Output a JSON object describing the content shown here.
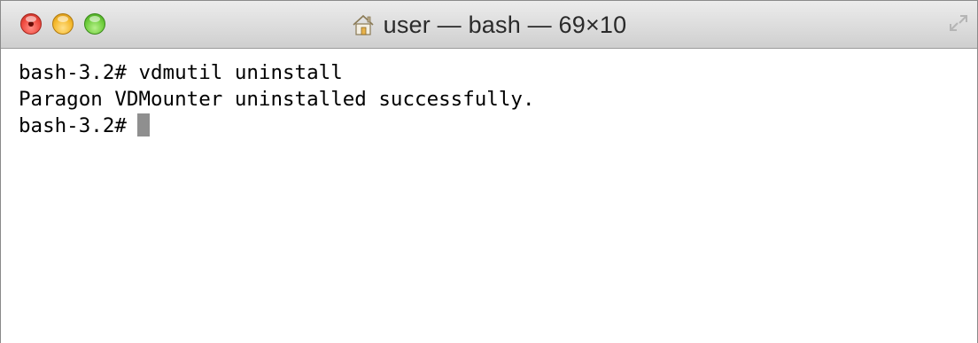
{
  "window": {
    "title": "user — bash — 69×10"
  },
  "icons": {
    "title_icon": "home-icon",
    "resize": "resize-icon"
  },
  "terminal": {
    "lines": [
      "bash-3.2# vdmutil uninstall",
      "Paragon VDMounter uninstalled successfully.",
      "bash-3.2#"
    ]
  },
  "colors": {
    "close": "#ef4a3f",
    "minimize": "#f5b92d",
    "zoom": "#6fcd3c",
    "cursor": "#8f8f8f",
    "text": "#000000"
  }
}
